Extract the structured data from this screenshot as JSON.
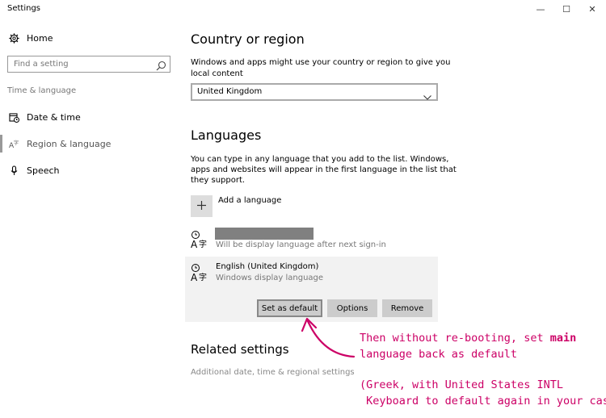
{
  "window": {
    "title": "Settings",
    "minimize_glyph": "—",
    "maximize_glyph": "☐",
    "close_glyph": "✕"
  },
  "sidebar": {
    "home_label": "Home",
    "search_placeholder": "Find a setting",
    "section_label": "Time & language",
    "items": [
      {
        "label": "Date & time",
        "icon": "calendar-clock-icon"
      },
      {
        "label": "Region & language",
        "icon": "region-language-icon",
        "selected": true
      },
      {
        "label": "Speech",
        "icon": "microphone-icon"
      }
    ]
  },
  "main": {
    "country": {
      "heading": "Country or region",
      "description_line1": "Windows and apps might use your country or region to give you",
      "description_line2": "local content",
      "selected_value": "United Kingdom"
    },
    "languages": {
      "heading": "Languages",
      "description_line1": "You can type in any language that you add to the list. Windows,",
      "description_line2": "apps and websites will appear in the first language in the list that",
      "description_line3": "they support.",
      "add_label": "Add a language",
      "list": [
        {
          "name": "",
          "status": "Will be display language after next sign-in"
        },
        {
          "name": "English (United Kingdom)",
          "status": "Windows display language"
        }
      ],
      "buttons": {
        "set_default": "Set as default",
        "options": "Options",
        "remove": "Remove"
      }
    },
    "related": {
      "heading": "Related settings",
      "link": "Additional date, time & regional settings"
    }
  },
  "annotation": {
    "line1_prefix": "Then without re-booting, set ",
    "line1_bold": "main",
    "line2": "language back as default",
    "line3": "(Greek, with United States INTL",
    "line4": " Keyboard to default again in your case)",
    "color": "#cc0066"
  }
}
